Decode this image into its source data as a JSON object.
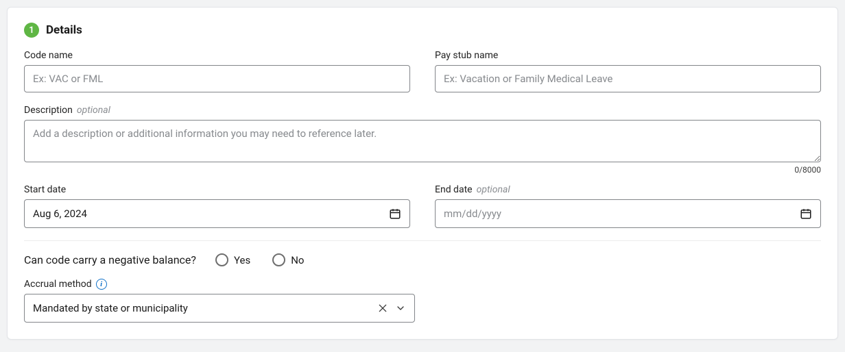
{
  "section": {
    "step": "1",
    "title": "Details"
  },
  "fields": {
    "code_name": {
      "label": "Code name",
      "placeholder": "Ex: VAC or FML",
      "value": ""
    },
    "pay_stub_name": {
      "label": "Pay stub name",
      "placeholder": "Ex: Vacation or Family Medical Leave",
      "value": ""
    },
    "description": {
      "label": "Description",
      "optional": "optional",
      "placeholder": "Add a description or additional information you may need to reference later.",
      "value": "",
      "char_count": "0/8000"
    },
    "start_date": {
      "label": "Start date",
      "value": "Aug 6, 2024"
    },
    "end_date": {
      "label": "End date",
      "optional": "optional",
      "placeholder": "mm/dd/yyyy",
      "value": ""
    }
  },
  "negative_balance": {
    "question": "Can code carry a negative balance?",
    "options": {
      "yes": "Yes",
      "no": "No"
    }
  },
  "accrual": {
    "label": "Accrual method",
    "value": "Mandated by state or municipality"
  }
}
